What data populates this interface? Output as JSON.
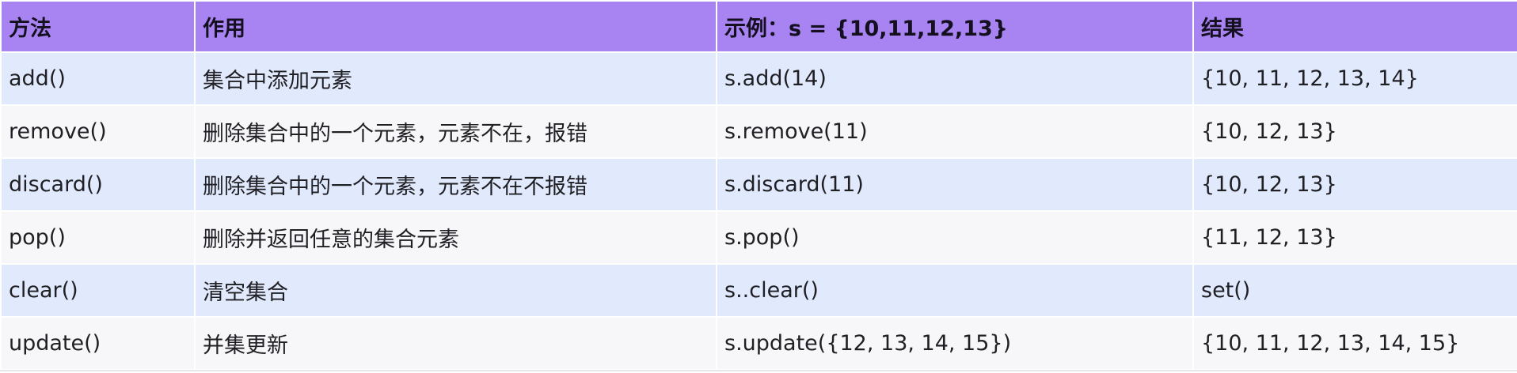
{
  "table": {
    "headers": [
      "方法",
      "作用",
      "示例：s = {10,11,12,13}",
      "结果"
    ],
    "rows": [
      [
        "add()",
        "集合中添加元素",
        "s.add(14)",
        "{10, 11, 12, 13, 14}"
      ],
      [
        "remove()",
        "删除集合中的一个元素，元素不在，报错",
        "s.remove(11)",
        "{10, 12, 13}"
      ],
      [
        "discard()",
        "删除集合中的一个元素，元素不在不报错",
        "s.discard(11)",
        "{10, 12, 13}"
      ],
      [
        "pop()",
        "删除并返回任意的集合元素",
        "s.pop()",
        "{11, 12, 13}"
      ],
      [
        "clear()",
        "清空集合",
        "s..clear()",
        "set()"
      ],
      [
        "update()",
        "并集更新",
        "s.update({12, 13, 14, 15})",
        "{10, 11, 12, 13, 14, 15}"
      ]
    ]
  },
  "colors": {
    "header_bg": "#a884f2",
    "row_odd_bg": "#e1e9fd",
    "row_even_bg": "#f7f7fa"
  }
}
